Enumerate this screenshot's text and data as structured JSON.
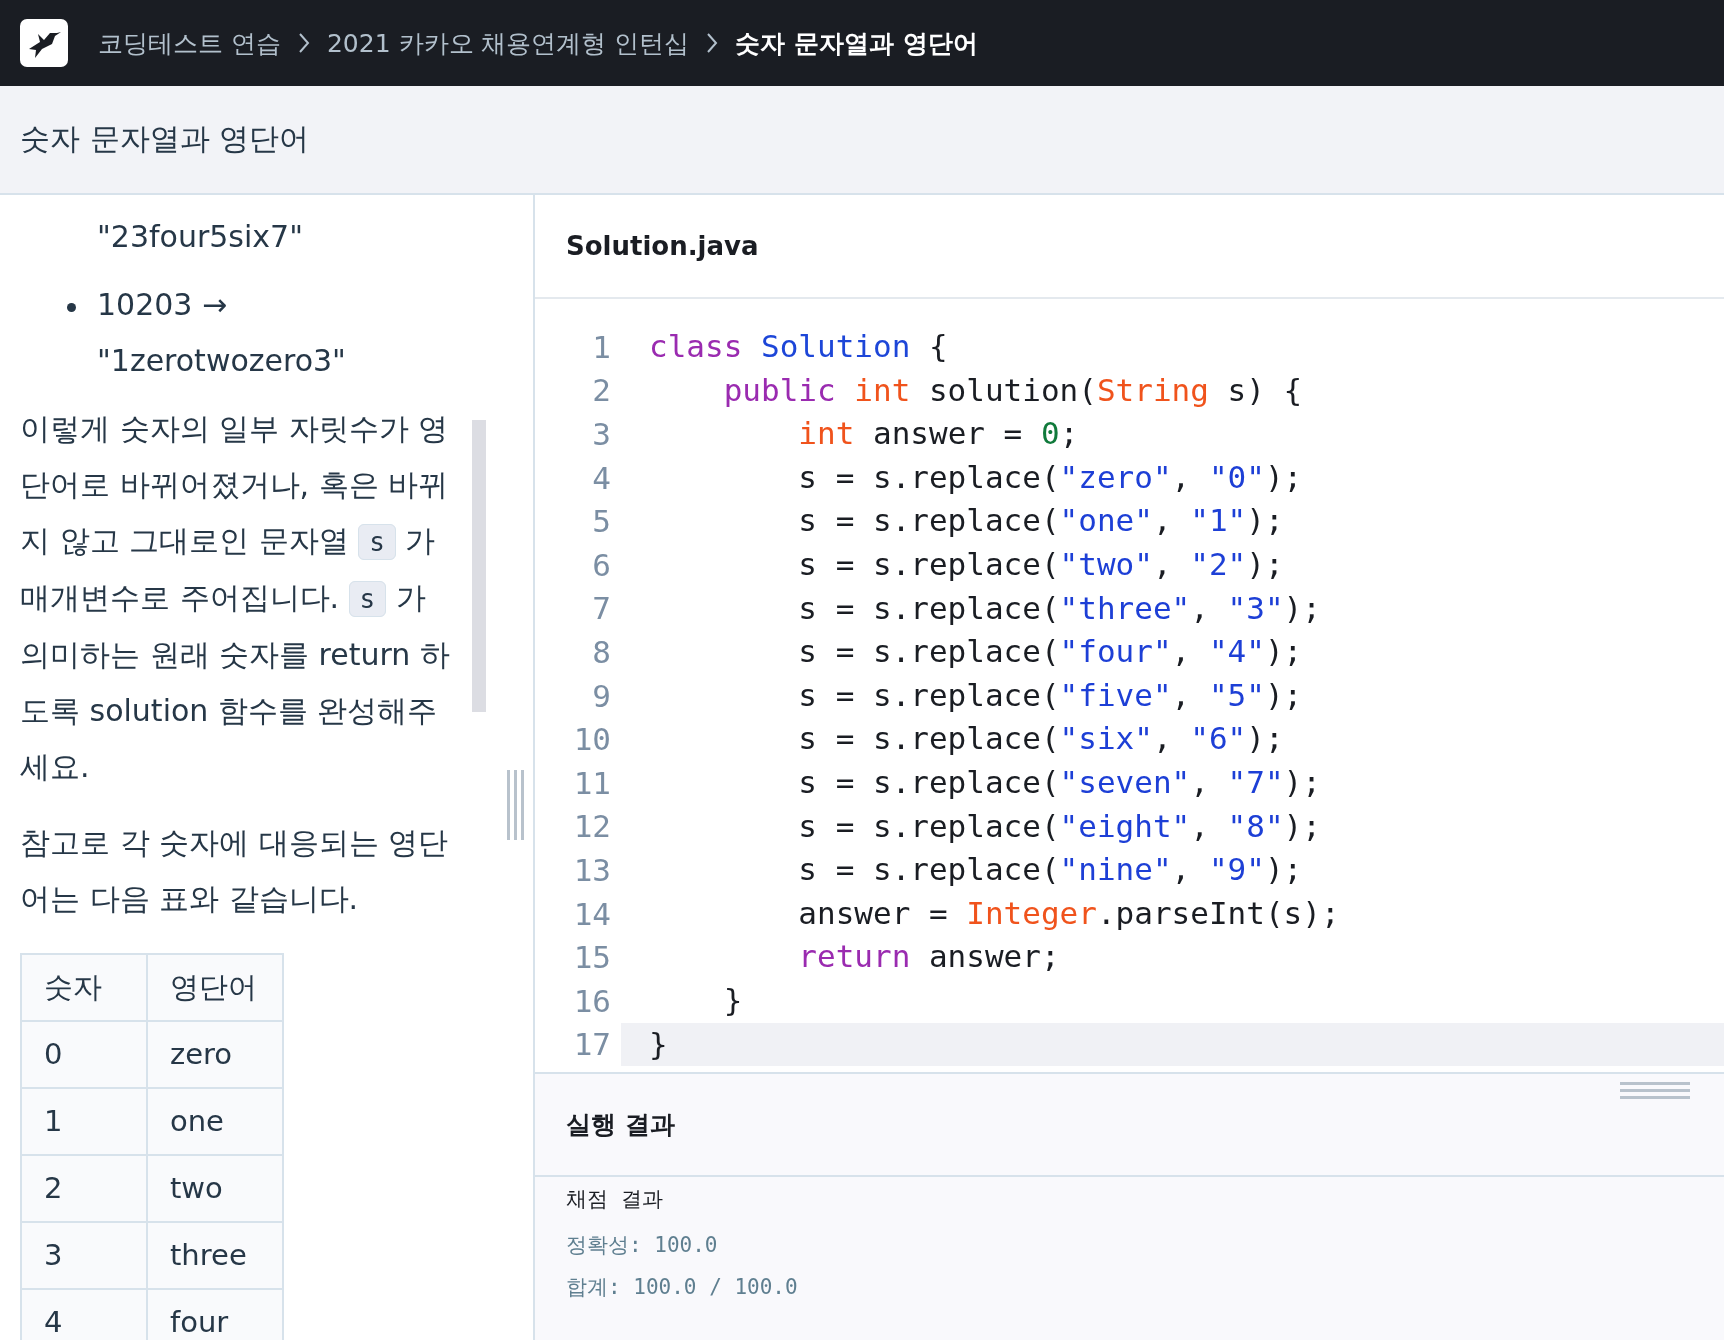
{
  "breadcrumb": [
    {
      "label": "코딩테스트 연습",
      "current": false
    },
    {
      "label": "2021 카카오 채용연계형 인턴십",
      "current": false
    },
    {
      "label": "숫자 문자열과 영단어",
      "current": true
    }
  ],
  "page_title": "숫자 문자열과 영단어",
  "description": {
    "examples": [
      {
        "text": "\"23four5six7\"",
        "bullet": false
      },
      {
        "text": "10203 → \"1zerotwozero3\"",
        "bullet": true
      }
    ],
    "paragraphs": [
      [
        {
          "kind": "text",
          "text": "이렇게 숫자의 일부 자릿수가 영단어로 바뀌어졌거나, 혹은 바뀌지 않고 그대로인 문자열 "
        },
        {
          "kind": "code",
          "text": "s"
        },
        {
          "kind": "text",
          "text": " 가 매개변수로 주어집니다. "
        },
        {
          "kind": "code",
          "text": "s"
        },
        {
          "kind": "text",
          "text": " 가 의미하는 원래 숫자를 return 하도록 solution 함수를 완성해주세요."
        }
      ],
      [
        {
          "kind": "text",
          "text": "참고로 각 숫자에 대응되는 영단어는 다음 표와 같습니다."
        }
      ]
    ],
    "table": {
      "columns": [
        "숫자",
        "영단어"
      ],
      "rows": [
        [
          "0",
          "zero"
        ],
        [
          "1",
          "one"
        ],
        [
          "2",
          "two"
        ],
        [
          "3",
          "three"
        ],
        [
          "4",
          "four"
        ]
      ]
    }
  },
  "editor": {
    "file_name": "Solution.java",
    "lines": [
      {
        "number": "1",
        "active": false,
        "tokens": [
          {
            "kind": "keyword",
            "text": "class"
          },
          {
            "kind": "classname",
            "text": " Solution"
          },
          {
            "kind": "plain",
            "text": " {"
          }
        ]
      },
      {
        "number": "2",
        "active": false,
        "tokens": [
          {
            "kind": "keyword",
            "text": "    public"
          },
          {
            "kind": "type",
            "text": " int"
          },
          {
            "kind": "plain",
            "text": " solution("
          },
          {
            "kind": "type",
            "text": "String"
          },
          {
            "kind": "plain",
            "text": " s) {"
          }
        ]
      },
      {
        "number": "3",
        "active": false,
        "tokens": [
          {
            "kind": "type",
            "text": "        int"
          },
          {
            "kind": "plain",
            "text": " answer = "
          },
          {
            "kind": "number",
            "text": "0"
          },
          {
            "kind": "plain",
            "text": ";"
          }
        ]
      },
      {
        "number": "4",
        "active": false,
        "tokens": [
          {
            "kind": "plain",
            "text": "        s = s.replace("
          },
          {
            "kind": "string",
            "text": "\"zero\""
          },
          {
            "kind": "plain",
            "text": ", "
          },
          {
            "kind": "string",
            "text": "\"0\""
          },
          {
            "kind": "plain",
            "text": ");"
          }
        ]
      },
      {
        "number": "5",
        "active": false,
        "tokens": [
          {
            "kind": "plain",
            "text": "        s = s.replace("
          },
          {
            "kind": "string",
            "text": "\"one\""
          },
          {
            "kind": "plain",
            "text": ", "
          },
          {
            "kind": "string",
            "text": "\"1\""
          },
          {
            "kind": "plain",
            "text": ");"
          }
        ]
      },
      {
        "number": "6",
        "active": false,
        "tokens": [
          {
            "kind": "plain",
            "text": "        s = s.replace("
          },
          {
            "kind": "string",
            "text": "\"two\""
          },
          {
            "kind": "plain",
            "text": ", "
          },
          {
            "kind": "string",
            "text": "\"2\""
          },
          {
            "kind": "plain",
            "text": ");"
          }
        ]
      },
      {
        "number": "7",
        "active": false,
        "tokens": [
          {
            "kind": "plain",
            "text": "        s = s.replace("
          },
          {
            "kind": "string",
            "text": "\"three\""
          },
          {
            "kind": "plain",
            "text": ", "
          },
          {
            "kind": "string",
            "text": "\"3\""
          },
          {
            "kind": "plain",
            "text": ");"
          }
        ]
      },
      {
        "number": "8",
        "active": false,
        "tokens": [
          {
            "kind": "plain",
            "text": "        s = s.replace("
          },
          {
            "kind": "string",
            "text": "\"four\""
          },
          {
            "kind": "plain",
            "text": ", "
          },
          {
            "kind": "string",
            "text": "\"4\""
          },
          {
            "kind": "plain",
            "text": ");"
          }
        ]
      },
      {
        "number": "9",
        "active": false,
        "tokens": [
          {
            "kind": "plain",
            "text": "        s = s.replace("
          },
          {
            "kind": "string",
            "text": "\"five\""
          },
          {
            "kind": "plain",
            "text": ", "
          },
          {
            "kind": "string",
            "text": "\"5\""
          },
          {
            "kind": "plain",
            "text": ");"
          }
        ]
      },
      {
        "number": "10",
        "active": false,
        "tokens": [
          {
            "kind": "plain",
            "text": "        s = s.replace("
          },
          {
            "kind": "string",
            "text": "\"six\""
          },
          {
            "kind": "plain",
            "text": ", "
          },
          {
            "kind": "string",
            "text": "\"6\""
          },
          {
            "kind": "plain",
            "text": ");"
          }
        ]
      },
      {
        "number": "11",
        "active": false,
        "tokens": [
          {
            "kind": "plain",
            "text": "        s = s.replace("
          },
          {
            "kind": "string",
            "text": "\"seven\""
          },
          {
            "kind": "plain",
            "text": ", "
          },
          {
            "kind": "string",
            "text": "\"7\""
          },
          {
            "kind": "plain",
            "text": ");"
          }
        ]
      },
      {
        "number": "12",
        "active": false,
        "tokens": [
          {
            "kind": "plain",
            "text": "        s = s.replace("
          },
          {
            "kind": "string",
            "text": "\"eight\""
          },
          {
            "kind": "plain",
            "text": ", "
          },
          {
            "kind": "string",
            "text": "\"8\""
          },
          {
            "kind": "plain",
            "text": ");"
          }
        ]
      },
      {
        "number": "13",
        "active": false,
        "tokens": [
          {
            "kind": "plain",
            "text": "        s = s.replace("
          },
          {
            "kind": "string",
            "text": "\"nine\""
          },
          {
            "kind": "plain",
            "text": ", "
          },
          {
            "kind": "string",
            "text": "\"9\""
          },
          {
            "kind": "plain",
            "text": ");"
          }
        ]
      },
      {
        "number": "14",
        "active": false,
        "tokens": [
          {
            "kind": "plain",
            "text": "        answer = "
          },
          {
            "kind": "type",
            "text": "Integer"
          },
          {
            "kind": "plain",
            "text": ".parseInt(s);"
          }
        ]
      },
      {
        "number": "15",
        "active": false,
        "tokens": [
          {
            "kind": "keyword",
            "text": "        return"
          },
          {
            "kind": "plain",
            "text": " answer;"
          }
        ]
      },
      {
        "number": "16",
        "active": false,
        "tokens": [
          {
            "kind": "plain",
            "text": "    }"
          }
        ]
      },
      {
        "number": "17",
        "active": true,
        "tokens": [
          {
            "kind": "plain",
            "text": "}"
          }
        ]
      }
    ]
  },
  "result": {
    "title": "실행 결과",
    "heading": "채점  결과",
    "lines": [
      "정확성: 100.0",
      "합계: 100.0 / 100.0"
    ]
  }
}
